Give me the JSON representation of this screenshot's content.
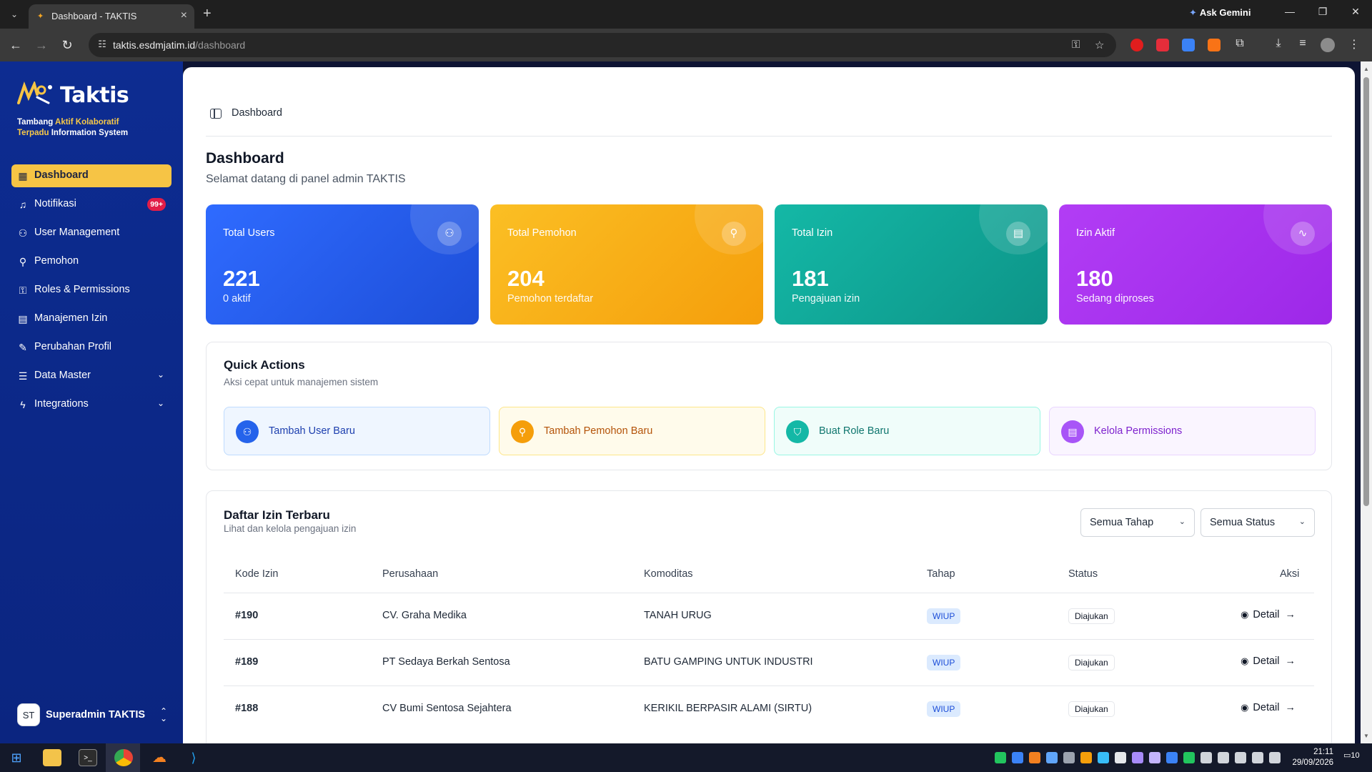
{
  "browser": {
    "tab_title": "Dashboard - TAKTIS",
    "url_host": "taktis.esdmjatim.id",
    "url_path": "/dashboard",
    "gemini_label": "Ask Gemini"
  },
  "brand": {
    "name": "Taktis",
    "tagline": [
      "Tambang ",
      "Aktif Kolaboratif",
      " ",
      "Terpadu",
      " Information System"
    ]
  },
  "sidebar": {
    "items": [
      {
        "label": "Dashboard",
        "icon": "grid-icon",
        "active": true
      },
      {
        "label": "Notifikasi",
        "icon": "bell-icon",
        "badge": "99+"
      },
      {
        "label": "User Management",
        "icon": "users-icon"
      },
      {
        "label": "Pemohon",
        "icon": "user-plus-icon"
      },
      {
        "label": "Roles & Permissions",
        "icon": "lock-icon"
      },
      {
        "label": "Manajemen Izin",
        "icon": "file-icon"
      },
      {
        "label": "Perubahan Profil",
        "icon": "file-edit-icon"
      },
      {
        "label": "Data Master",
        "icon": "database-icon",
        "expandable": true
      },
      {
        "label": "Integrations",
        "icon": "zap-icon",
        "expandable": true
      }
    ],
    "user": {
      "initials": "ST",
      "name": "Superadmin TAKTIS"
    }
  },
  "breadcrumb": "Dashboard",
  "page": {
    "title": "Dashboard",
    "subtitle": "Selamat datang di panel admin TAKTIS"
  },
  "stats": [
    {
      "label": "Total Users",
      "value": "221",
      "sub": "0 aktif",
      "color_from": "#2f6bff",
      "color_to": "#1d4ed8",
      "icon": "users-icon"
    },
    {
      "label": "Total Pemohon",
      "value": "204",
      "sub": "Pemohon terdaftar",
      "color_from": "#fbbf24",
      "color_to": "#f59e0b",
      "icon": "user-plus-icon"
    },
    {
      "label": "Total Izin",
      "value": "181",
      "sub": "Pengajuan izin",
      "color_from": "#14b8a6",
      "color_to": "#0d9488",
      "icon": "file-icon"
    },
    {
      "label": "Izin Aktif",
      "value": "180",
      "sub": "Sedang diproses",
      "color_from": "#b23df5",
      "color_to": "#9d28e8",
      "icon": "activity-icon"
    }
  ],
  "quick_actions": {
    "title": "Quick Actions",
    "subtitle": "Aksi cepat untuk manajemen sistem",
    "items": [
      {
        "label": "Tambah User Baru",
        "icon": "users-icon",
        "bg": "#eff6ff",
        "border": "#bfdbfe",
        "accent": "#2563eb",
        "text": "#1e40af"
      },
      {
        "label": "Tambah Pemohon Baru",
        "icon": "user-plus-icon",
        "bg": "#fffbeb",
        "border": "#fde68a",
        "accent": "#f59e0b",
        "text": "#b45309"
      },
      {
        "label": "Buat Role Baru",
        "icon": "shield-icon",
        "bg": "#f0fdfa",
        "border": "#99f6e4",
        "accent": "#14b8a6",
        "text": "#0f766e"
      },
      {
        "label": "Kelola Permissions",
        "icon": "file-icon",
        "bg": "#faf5ff",
        "border": "#e9d5ff",
        "accent": "#a855f7",
        "text": "#7e22ce"
      }
    ]
  },
  "izin_table": {
    "title": "Daftar Izin Terbaru",
    "subtitle": "Lihat dan kelola pengajuan izin",
    "filter_tahap": "Semua Tahap",
    "filter_status": "Semua Status",
    "columns": [
      "Kode Izin",
      "Perusahaan",
      "Komoditas",
      "Tahap",
      "Status",
      "Aksi"
    ],
    "rows": [
      {
        "kode": "#190",
        "perusahaan": "CV. Graha Medika",
        "komoditas": "TANAH URUG",
        "tahap": "WIUP",
        "status": "Diajukan",
        "aksi": "Detail"
      },
      {
        "kode": "#189",
        "perusahaan": "PT Sedaya Berkah Sentosa",
        "komoditas": "BATU GAMPING UNTUK INDUSTRI",
        "tahap": "WIUP",
        "status": "Diajukan",
        "aksi": "Detail"
      },
      {
        "kode": "#188",
        "perusahaan": "CV Bumi Sentosa Sejahtera",
        "komoditas": "KERIKIL BERPASIR ALAMI (SIRTU)",
        "tahap": "WIUP",
        "status": "Diajukan",
        "aksi": "Detail"
      }
    ]
  },
  "taskbar": {
    "time": "21:11",
    "date": "29/09/2026",
    "notif_count": "10"
  }
}
